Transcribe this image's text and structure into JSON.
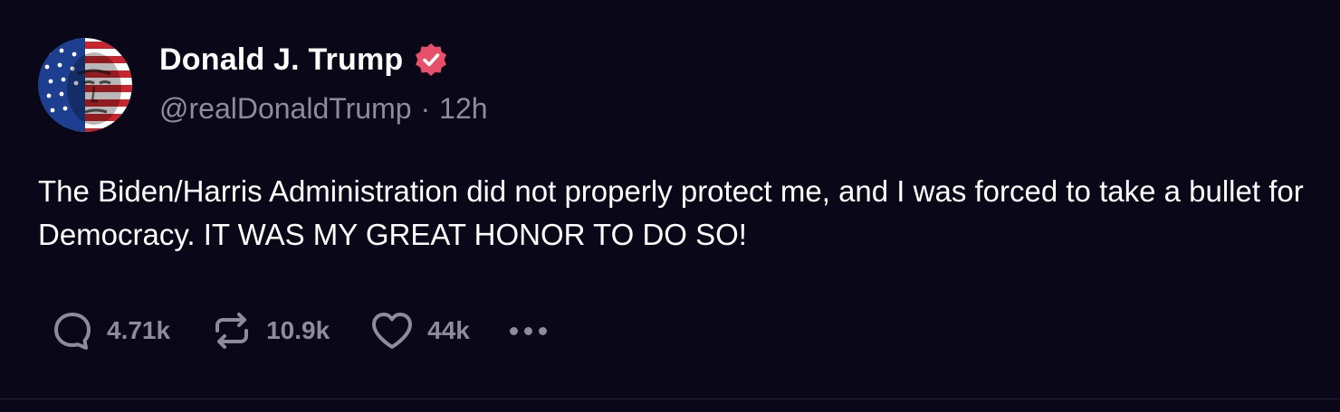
{
  "post": {
    "author": {
      "display_name": "Donald J. Trump",
      "handle": "@realDonaldTrump",
      "verified": true,
      "badge_color": "#e84f6b",
      "avatar_icon": "flag-portrait-avatar"
    },
    "separator": "·",
    "time_ago": "12h",
    "text": "The Biden/Harris Administration did not properly protect me, and I was forced to take a bullet for Democracy. IT WAS MY GREAT HONOR TO DO SO!",
    "actions": {
      "replies": "4.71k",
      "reposts": "10.9k",
      "likes": "44k"
    }
  },
  "colors": {
    "background": "#0a0719",
    "text_primary": "#ffffff",
    "text_muted": "#8d8b9c"
  }
}
